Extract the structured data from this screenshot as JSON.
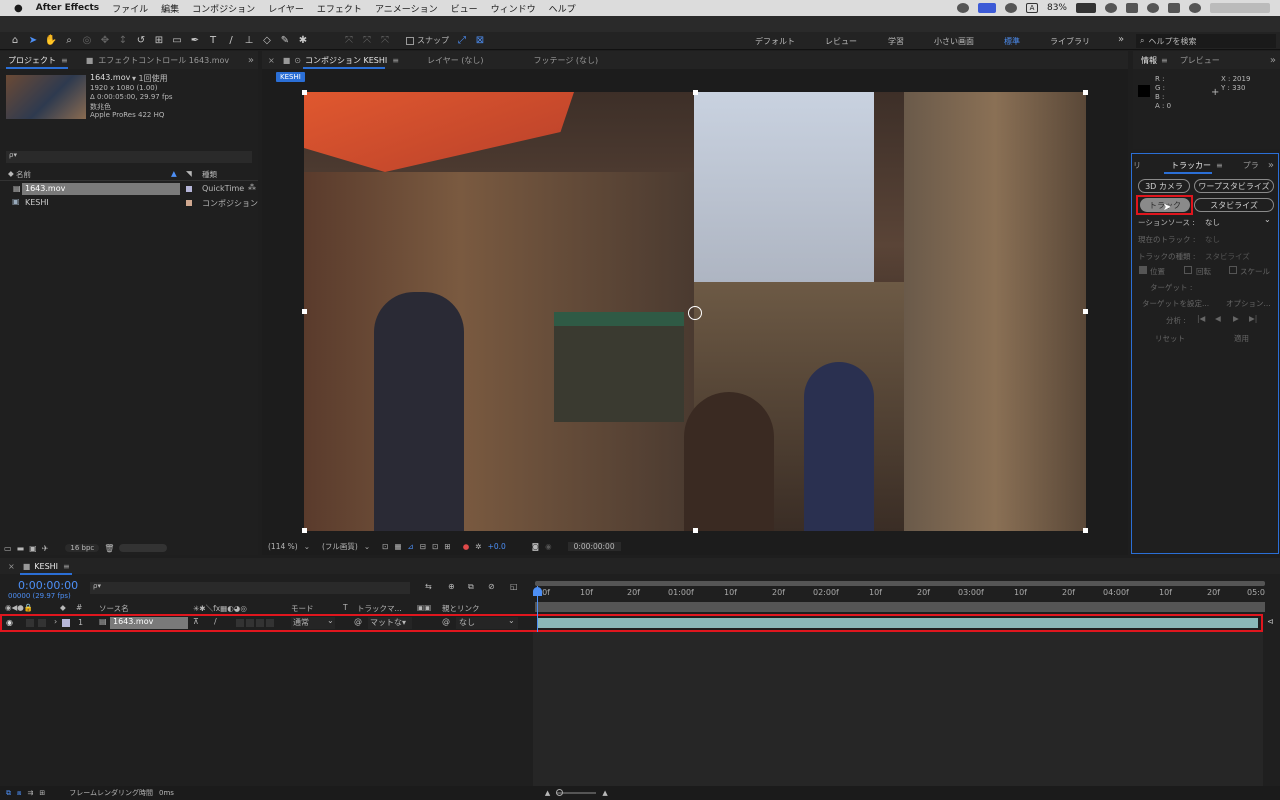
{
  "menubar": {
    "apple": "",
    "app": "After Effects",
    "items": [
      "ファイル",
      "編集",
      "コンポジション",
      "レイヤー",
      "エフェクト",
      "アニメーション",
      "ビュー",
      "ウィンドウ",
      "ヘルプ"
    ],
    "battery": "83%"
  },
  "toolbar": {
    "snap_label": "スナップ",
    "workspaces": [
      "デフォルト",
      "レビュー",
      "学習",
      "小さい画面",
      "標準",
      "ライブラリ"
    ],
    "active_workspace": "標準",
    "help_search_placeholder": "ヘルプを検索"
  },
  "project_panel": {
    "tabs": [
      "プロジェクト",
      "エフェクトコントロール 1643.mov"
    ],
    "footage_name": "1643.mov",
    "usage": "▾ 1回使用",
    "resolution": "1920 x 1080 (1.00)",
    "duration": "Δ 0:00:05:00, 29.97 fps",
    "color_label": "数兆色",
    "codec": "Apple ProRes 422 HQ",
    "search_placeholder": "ρ▾",
    "col_name": "名前",
    "col_type": "種類",
    "items": [
      {
        "name": "1643.mov",
        "type": "QuickTime",
        "selected": true
      },
      {
        "name": "KESHI",
        "type": "コンポジション",
        "selected": false
      }
    ],
    "bpc": "16 bpc"
  },
  "comp_panel": {
    "tabs": [
      "コンポジション KESHI",
      "レイヤー (なし)",
      "フッテージ (なし)"
    ],
    "comp_chip": "KESHI",
    "zoom": "(114 %)",
    "quality": "(フル画質)",
    "exposure": "+0.0",
    "timecode": "0:00:00:00"
  },
  "info_panel": {
    "tabs": [
      "情報",
      "プレビュー"
    ],
    "r": "R :",
    "g": "G :",
    "b": "B :",
    "a": "A : 0",
    "x": "X : 2019",
    "y": "Y : 330"
  },
  "tracker_panel": {
    "tabs_left": "リ",
    "title": "トラッカー",
    "tab_right": "プラ",
    "btn_3d": "3D カメラ",
    "btn_warp": "ワープスタビライズ",
    "btn_track": "トラック",
    "btn_stab": "スタビライズ",
    "motion_source_label": "ーションソース :",
    "motion_source_value": "なし",
    "current_track_label": "現在のトラック :",
    "current_track_value": "なし",
    "track_type_label": "トラックの種類 :",
    "track_type_value": "スタビライズ",
    "chk_position": "位置",
    "chk_rotation": "回転",
    "chk_scale": "スケール",
    "target_label": "ターゲット :",
    "set_target": "ターゲットを設定...",
    "options": "オプション...",
    "analyze": "分析 :",
    "reset": "リセット",
    "apply": "適用"
  },
  "timeline": {
    "comp_tab": "KESHI",
    "timecode": "0:00:00:00",
    "frames": "00000 (29.97 fps)",
    "col_source": "ソース名",
    "col_mode": "モード",
    "col_t": "T",
    "col_trackmatte": "トラックマ...",
    "col_parent": "親とリンク",
    "layer_num": "1",
    "layer_name": "1643.mov",
    "layer_mode": "通常",
    "layer_matte": "マットな▾",
    "layer_parent": "なし",
    "ruler": [
      "00f",
      "10f",
      "20f",
      "01:00f",
      "10f",
      "20f",
      "02:00f",
      "10f",
      "20f",
      "03:00f",
      "10f",
      "20f",
      "04:00f",
      "10f",
      "20f",
      "05:0"
    ],
    "render_time_label": "フレームレンダリング時間",
    "render_time_value": "0ms"
  },
  "colors": {
    "accent": "#2b6fd6",
    "highlight": "#e0161e",
    "layer_bar": "#8ab8b8"
  }
}
